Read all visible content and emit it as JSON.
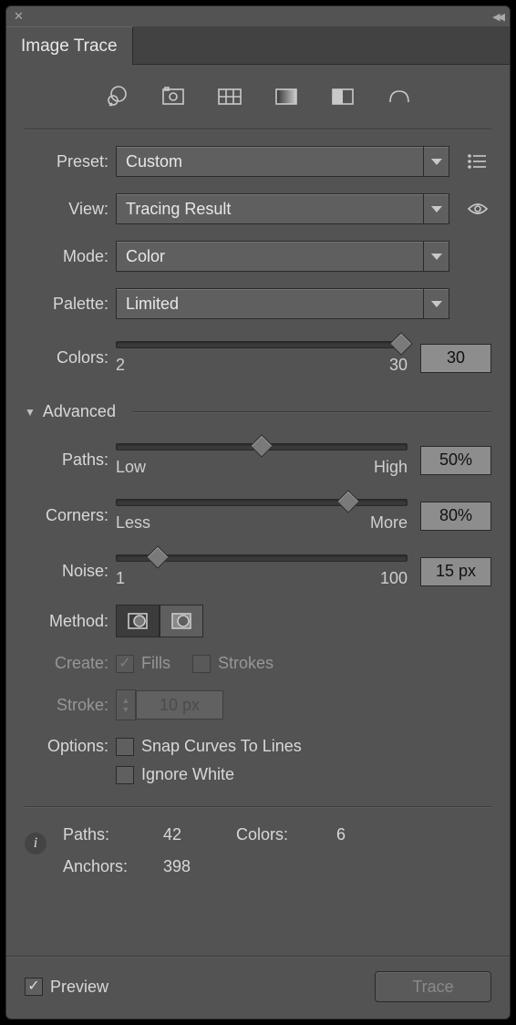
{
  "window": {
    "close_glyph": "✕",
    "collapse_glyph": "◀◀"
  },
  "tab": {
    "title": "Image Trace"
  },
  "preset": {
    "label": "Preset:",
    "value": "Custom"
  },
  "view": {
    "label": "View:",
    "value": "Tracing Result"
  },
  "mode": {
    "label": "Mode:",
    "value": "Color"
  },
  "palette": {
    "label": "Palette:",
    "value": "Limited"
  },
  "colors": {
    "label": "Colors:",
    "value": "30",
    "min": "2",
    "max": "30"
  },
  "advanced": {
    "title": "Advanced"
  },
  "paths": {
    "label": "Paths:",
    "value": "50%",
    "min": "Low",
    "max": "High"
  },
  "corners": {
    "label": "Corners:",
    "value": "80%",
    "min": "Less",
    "max": "More"
  },
  "noise": {
    "label": "Noise:",
    "value": "15 px",
    "min": "1",
    "max": "100"
  },
  "method": {
    "label": "Method:"
  },
  "create": {
    "label": "Create:",
    "fills": "Fills",
    "strokes": "Strokes"
  },
  "stroke": {
    "label": "Stroke:",
    "value": "10 px"
  },
  "options": {
    "label": "Options:",
    "snap": "Snap Curves To Lines",
    "ignore": "Ignore White"
  },
  "info": {
    "paths_label": "Paths:",
    "paths_value": "42",
    "colors_label": "Colors:",
    "colors_value": "6",
    "anchors_label": "Anchors:",
    "anchors_value": "398"
  },
  "preview": {
    "label": "Preview"
  },
  "trace_btn": {
    "label": "Trace"
  }
}
